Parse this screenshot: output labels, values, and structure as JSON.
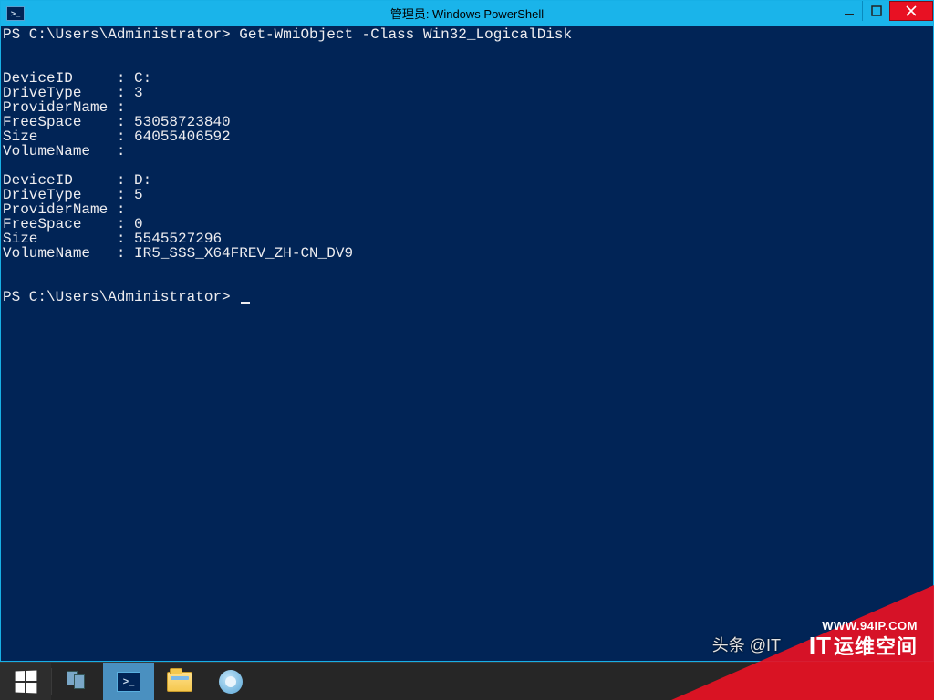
{
  "window": {
    "title": "管理员: Windows PowerShell",
    "icon_label": ">_"
  },
  "console": {
    "prompt1": "PS C:\\Users\\Administrator> ",
    "command": "Get-WmiObject -Class Win32_LogicalDisk",
    "disks": [
      {
        "DeviceID": "C:",
        "DriveType": "3",
        "ProviderName": "",
        "FreeSpace": "53058723840",
        "Size": "64055406592",
        "VolumeName": ""
      },
      {
        "DeviceID": "D:",
        "DriveType": "5",
        "ProviderName": "",
        "FreeSpace": "0",
        "Size": "5545527296",
        "VolumeName": "IR5_SSS_X64FREV_ZH-CN_DV9"
      }
    ],
    "fields": [
      "DeviceID",
      "DriveType",
      "ProviderName",
      "FreeSpace",
      "Size",
      "VolumeName"
    ],
    "field_width": 13,
    "prompt2": "PS C:\\Users\\Administrator> "
  },
  "taskbar": {
    "items": [
      {
        "name": "start-button"
      },
      {
        "name": "server-manager"
      },
      {
        "name": "powershell",
        "active": true
      },
      {
        "name": "file-explorer"
      },
      {
        "name": "settings-gear"
      }
    ]
  },
  "watermark": {
    "head": "头条 @IT",
    "url": "WWW.94IP.COM",
    "brand_prefix": "IT",
    "brand_text": "运维空间"
  },
  "colors": {
    "console_bg": "#012456",
    "console_fg": "#eeedf0",
    "titlebar": "#1ab4ea",
    "close": "#e81123",
    "accent_red": "#e81123"
  }
}
